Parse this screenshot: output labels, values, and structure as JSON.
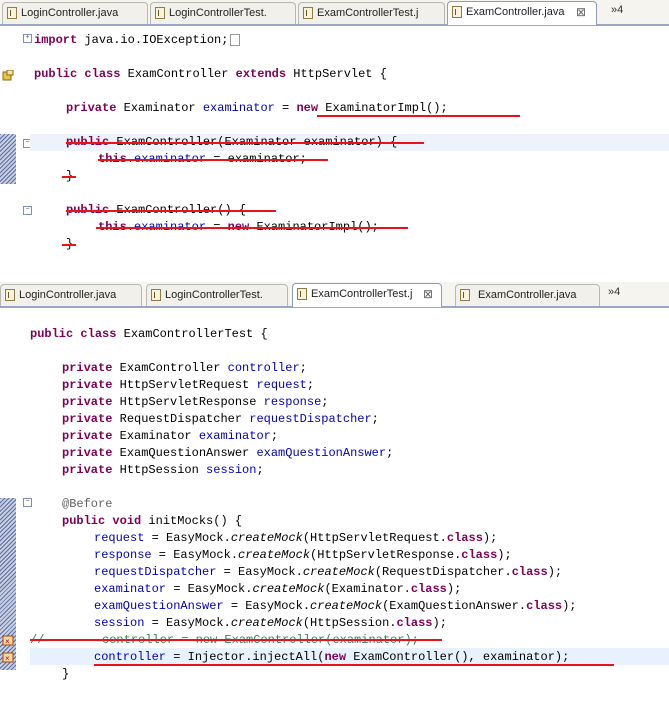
{
  "top": {
    "tabs": [
      {
        "label": "LoginController.java",
        "active": false
      },
      {
        "label": "LoginControllerTest.",
        "active": false
      },
      {
        "label": "ExamControllerTest.j",
        "active": false
      },
      {
        "label": "ExamController.java",
        "active": true
      }
    ],
    "overflow": "»4",
    "code": {
      "import_kw": "import",
      "import_rest": " java.io.IOException;",
      "l2_kw1": "public",
      "l2_kw2": "class",
      "l2_name": " ExamController ",
      "l2_kw3": "extends",
      "l2_rest": " HttpServlet {",
      "l3_kw": "private",
      "l3_type": " Examinator ",
      "l3_field": "examinator",
      "l3_eq": " = ",
      "l3_new": "new",
      "l3_rest": " ExaminatorImpl();",
      "l4_kw": "public",
      "l4_rest": " ExamController(Examinator examinator) {",
      "l5_kw": "this",
      "l5_dot": ".",
      "l5_field": "examinator",
      "l5_rest": " = examinator;",
      "l6": "}",
      "l7_kw": "public",
      "l7_rest": " ExamController() {",
      "l8_kw": "this",
      "l8_dot": ".",
      "l8_field": "examinator",
      "l8_eq": " = ",
      "l8_new": "new",
      "l8_rest": " ExaminatorImpl();",
      "l9": "}"
    }
  },
  "bottom": {
    "tabs": [
      {
        "label": "LoginController.java",
        "active": false
      },
      {
        "label": "LoginControllerTest.",
        "active": false
      },
      {
        "label": "ExamControllerTest.j",
        "active": true
      },
      {
        "label": "ExamController.java",
        "active": false
      }
    ],
    "overflow": "»4",
    "code": {
      "c1_kw1": "public",
      "c1_kw2": "class",
      "c1_rest": " ExamControllerTest {",
      "fields": [
        {
          "kw": "private",
          "type": " ExamController ",
          "name": "controller"
        },
        {
          "kw": "private",
          "type": " HttpServletRequest ",
          "name": "request"
        },
        {
          "kw": "private",
          "type": " HttpServletResponse ",
          "name": "response"
        },
        {
          "kw": "private",
          "type": " RequestDispatcher ",
          "name": "requestDispatcher"
        },
        {
          "kw": "private",
          "type": " Examinator ",
          "name": "examinator"
        },
        {
          "kw": "private",
          "type": " ExamQuestionAnswer ",
          "name": "examQuestionAnswer"
        },
        {
          "kw": "private",
          "type": " HttpSession ",
          "name": "session"
        }
      ],
      "annotation": "@Before",
      "m_kw1": "public",
      "m_kw2": "void",
      "m_rest": " initMocks() {",
      "mocks": [
        {
          "field": "request",
          "pre": " = EasyMock.",
          "method": "createMock",
          "arg": "(HttpServletRequest.",
          "cls": "class",
          "end": ");"
        },
        {
          "field": "response",
          "pre": " = EasyMock.",
          "method": "createMock",
          "arg": "(HttpServletResponse.",
          "cls": "class",
          "end": ");"
        },
        {
          "field": "requestDispatcher",
          "pre": " = EasyMock.",
          "method": "createMock",
          "arg": "(RequestDispatcher.",
          "cls": "class",
          "end": ");"
        },
        {
          "field": "examinator",
          "pre": " = EasyMock.",
          "method": "createMock",
          "arg": "(Examinator.",
          "cls": "class",
          "end": ");"
        },
        {
          "field": "examQuestionAnswer",
          "pre": " = EasyMock.",
          "method": "createMock",
          "arg": "(ExamQuestionAnswer.",
          "cls": "class",
          "end": ");"
        },
        {
          "field": "session",
          "pre": " = EasyMock.",
          "method": "createMock",
          "arg": "(HttpSession.",
          "cls": "class",
          "end": ");"
        }
      ],
      "commented": "//        controller = new ExamController(examinator);",
      "inj_field": "controller",
      "inj_mid": " = ",
      "inj_cls": "Injector",
      "inj_call": ".injectAll(",
      "inj_new": "new",
      "inj_rest": " ExamController(), examinator);",
      "close": "}"
    }
  },
  "colors": {
    "keyword": "#7f0055",
    "field": "#0000c0",
    "annotation": "#646464",
    "strike": "#e8141a",
    "comment": "#3f7f5f"
  }
}
